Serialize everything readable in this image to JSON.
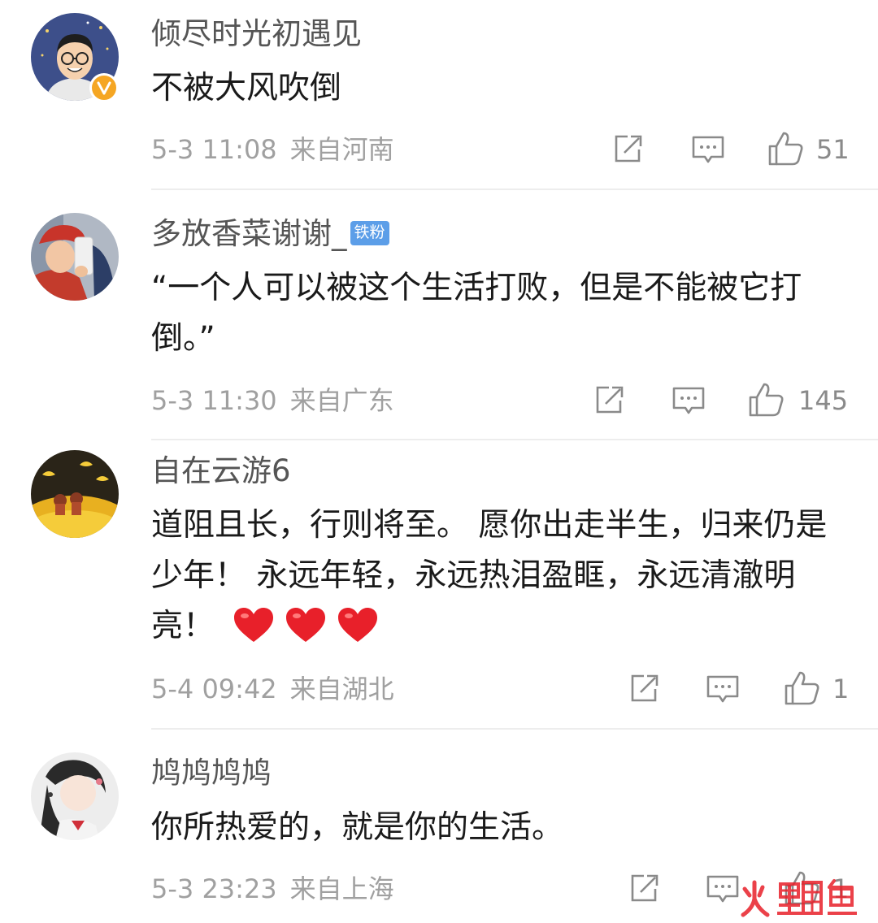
{
  "comments": [
    {
      "username": "倾尽时光初遇见",
      "verified": true,
      "text": "不被大风吹倒",
      "time": "5-3 11:08",
      "location": "来自河南",
      "likes": "51"
    },
    {
      "username": "多放香菜谢谢_",
      "badge": "铁粉",
      "text": "“一个人可以被这个生活打败，但是不能被它打倒。”",
      "time": "5-3 11:30",
      "location": "来自广东",
      "likes": "145"
    },
    {
      "username": "自在云游6",
      "text": "道阻且长，行则将至。 愿你出走半生，归来仍是少年！ 永远年轻，永远热泪盈眶，永远清澈明亮！",
      "emoji": "heart-emoji",
      "emoji_count": 3,
      "time": "5-4 09:42",
      "location": "来自湖北",
      "likes": "1"
    },
    {
      "username": "鸠鸠鸠鸠",
      "text": "你所热爱的，就是你的生活。",
      "time": "5-3 23:23",
      "location": "来自上海",
      "likes": "1"
    }
  ],
  "watermark": "火鲤鱼",
  "icons": {
    "repost": "repost-icon",
    "comment": "comment-icon",
    "like": "thumbs-up-icon",
    "verified": "verified-v-icon"
  },
  "colors": {
    "text": "#1a1a1a",
    "username": "#555555",
    "meta": "#a0a0a0",
    "badge": "#5c9ee8",
    "verified": "#f5a623",
    "heart": "#e8202a",
    "watermark": "#e8202a"
  }
}
